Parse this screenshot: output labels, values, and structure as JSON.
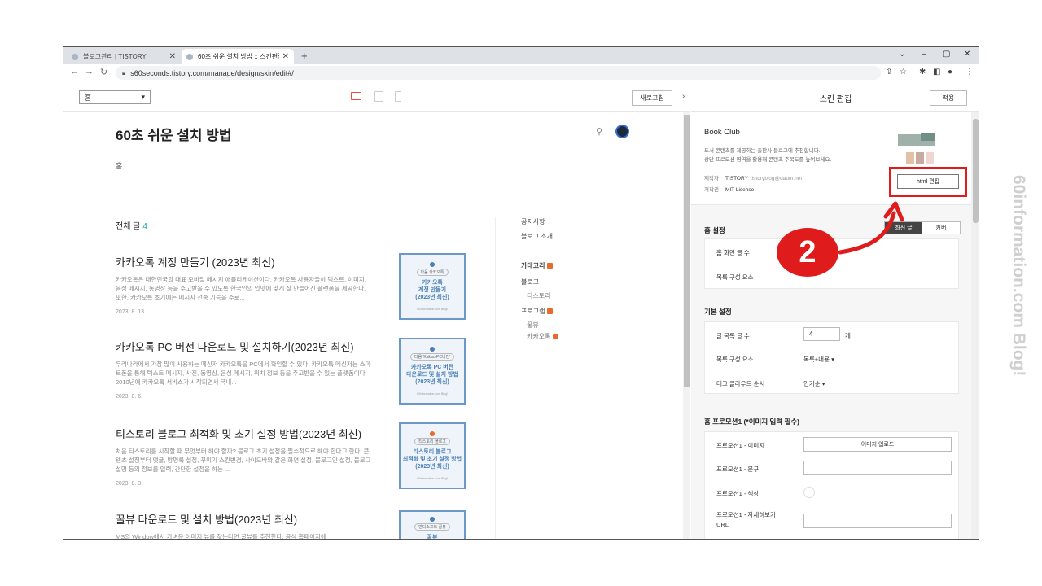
{
  "tabs": [
    {
      "label": "블로그관리 | TISTORY",
      "active": false
    },
    {
      "label": "60초 쉬운 설치 방법 :: 스킨편집",
      "active": true
    }
  ],
  "address": {
    "url": "s60seconds.tistory.com/manage/design/skin/edit#/"
  },
  "preview": {
    "page_select": "홈",
    "refresh_label": "새로고침",
    "blog_title": "60초 쉬운 설치 방법",
    "home_link": "홈",
    "all_posts_label": "전체 글",
    "all_posts_count": "4",
    "posts": [
      {
        "title": "카카오톡 계정 만들기 (2023년 최신)",
        "excerpt": "카카오톡은 대한민국의 대표 모바일 메시지 애플리케이션이다. 카카오톡 사용자들이 텍스트, 이미지, 음성 메시지, 동영상 등을 주고받을 수 있도록 한국인의 입맛에 맞게 잘 만들어진 플랫폼을 제공한다. 또한, 카카오톡 초기에는 메시지 전송 기능을 주로...",
        "date": "2023. 8. 13.",
        "thumb_pill": "다음 카카오톡",
        "thumb_text": "카카오톡\n계정 만들기\n(2023년 최신)",
        "thumb_foot": "60information.com Blog!"
      },
      {
        "title": "카카오톡 PC 버전 다운로드 및 설치하기(2023년 최신)",
        "excerpt": "우리나라에서 가장 많이 사용하는 메신저 카카오톡을 PC에서 확인할 수 있다. 카카오톡 메신저는 스마트폰을 통해 텍스트 메시지, 사진, 동영상, 음성 메시지, 위치 정보 등을 주고받을 수 있는 플랫폼이다. 2010년에 카카오톡 서비스가 시작되면서 국내...",
        "date": "2023. 8. 6.",
        "thumb_pill": "다음 'Kakao PC버전'",
        "thumb_text": "카카오톡 PC 버전\n다운로드 및 설치 방법\n(2023년 최신)",
        "thumb_foot": "60information.com Blog!"
      },
      {
        "title": "티스토리 블로그 최적화 및 초기 설정 방법(2023년 최신)",
        "excerpt": "처음 티스토리를 시작할 때 무엇부터 해야 할까? 블로그 초기 설정을 필수적으로 해야 한다고 한다. 콘텐츠 설정부터 댓글, 방명록 설정, 꾸미기 스킨변경, 사이드바와 같은 화면 설정, 블로그인 설정, 블로그 설명 등의 정보를 입력, 간단한 설정을 하는 ...",
        "date": "2023. 8. 3.",
        "thumb_pill": "티스토리 블로그",
        "thumb_text": "티스토리 블로그\n최적화 및 초기 설정 방법\n(2023년 최신)",
        "thumb_foot": "60information.com Blog!"
      },
      {
        "title": "꿀뷰 다운로드 및 설치 방법(2023년 최신)",
        "excerpt": "MS의 Window에서 가벼운 이미지 뷰를 찾는다면 꿀뷰를 추천한다. 공식 홈페이지에",
        "date": "",
        "thumb_pill": "반디소프트 꿀뷰",
        "thumb_text": "꿀뷰",
        "thumb_foot": ""
      }
    ],
    "sidebar": {
      "notice": "공지사항",
      "about": "블로그 소개",
      "category": "카테고리",
      "blog": "블로그",
      "tistory": "티스토리",
      "program": "프로그램",
      "kkulview": "꿀뷰",
      "kakaotalk": "카카오톡"
    }
  },
  "editor": {
    "title": "스킨 편집",
    "apply_label": "적용",
    "skin": {
      "name": "Book Club",
      "desc_line1": "도서 콘텐츠를 제공하는 출판사 블로그에 추천합니다.",
      "desc_line2": "상단 프로모션 영역을 활용해 콘텐츠 주목도를 높여보세요.",
      "maker_key": "제작자",
      "maker_val": "TISTORY",
      "maker_email": "tistoryblog@daum.net",
      "license_key": "저작권",
      "license_val": "MIT License",
      "html_edit_label": "html 편집"
    },
    "home_settings": {
      "title": "홈 설정",
      "seg_latest": "최신 글",
      "seg_cover": "커버",
      "row1": "홈 화면 글 수",
      "row2": "목록 구성 요소"
    },
    "basic_settings": {
      "title": "기본 설정",
      "post_count_label": "글 목록 글 수",
      "post_count_value": "4",
      "post_count_unit": "개",
      "list_elem_label": "목록 구성 요소",
      "list_elem_value": "목록+내용",
      "tag_order_label": "태그 클라우드 순서",
      "tag_order_value": "인기순"
    },
    "promo": {
      "title": "홈 프로모션1 (*이미지 입력 필수)",
      "image_label": "프로모션1 - 이미지",
      "upload_label": "이미지 업로드",
      "text_label": "프로모션1 - 문구",
      "color_label": "프로모션1 - 색상",
      "url_label_1": "프로모션1 - 자세히보기",
      "url_label_2": "URL"
    }
  },
  "annotation": {
    "step": "2",
    "color": "#e01b1b"
  },
  "watermark": "60information.com Blog!"
}
